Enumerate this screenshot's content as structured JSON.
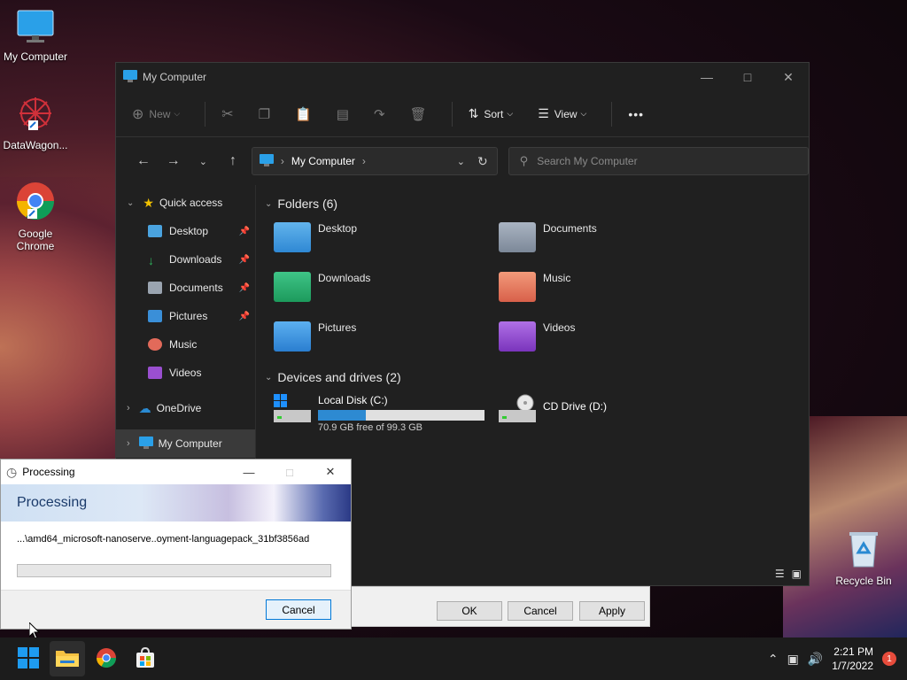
{
  "desktop": {
    "icons": [
      {
        "label": "My Computer",
        "icon": "monitor-icon"
      },
      {
        "label": "DataWagon...",
        "icon": "datawagon-icon"
      },
      {
        "label": "Google Chrome",
        "icon": "chrome-icon"
      },
      {
        "label": "Recycle Bin",
        "icon": "recycle-bin-icon"
      }
    ]
  },
  "explorer": {
    "title": "My Computer",
    "toolbar": {
      "new_label": "New",
      "sort_label": "Sort",
      "view_label": "View",
      "more_label": "•••"
    },
    "address": {
      "crumb": "My Computer"
    },
    "search": {
      "placeholder": "Search My Computer"
    },
    "sidebar": {
      "quick_access": "Quick access",
      "items": [
        {
          "label": "Desktop",
          "pinned": true,
          "color": "#4aa3df"
        },
        {
          "label": "Downloads",
          "pinned": true,
          "color": "#2fb35c"
        },
        {
          "label": "Documents",
          "pinned": true,
          "color": "#9aa4b0"
        },
        {
          "label": "Pictures",
          "pinned": true,
          "color": "#3a8fd8"
        },
        {
          "label": "Music",
          "pinned": false,
          "color": "#e26a5a"
        },
        {
          "label": "Videos",
          "pinned": false,
          "color": "#9a4fd0"
        }
      ],
      "onedrive": "OneDrive",
      "mycomputer": "My Computer"
    },
    "folders_header": "Folders (6)",
    "folders": [
      {
        "label": "Desktop",
        "color": "#3d9be0"
      },
      {
        "label": "Documents",
        "color": "#8a96a6"
      },
      {
        "label": "Downloads",
        "color": "#22a86a"
      },
      {
        "label": "Music",
        "color": "#e6765a"
      },
      {
        "label": "Pictures",
        "color": "#3a8fe0"
      },
      {
        "label": "Videos",
        "color": "#8e44c8"
      }
    ],
    "devices_header": "Devices and drives (2)",
    "drives": {
      "local": {
        "label": "Local Disk (C:)",
        "free": "70.9 GB free of 99.3 GB",
        "used_fraction": 0.286
      },
      "cd": {
        "label": "CD Drive (D:)"
      }
    }
  },
  "back_dialog": {
    "ok": "OK",
    "cancel": "Cancel",
    "apply": "Apply"
  },
  "processing": {
    "title": "Processing",
    "banner": "Processing",
    "path": "...\\amd64_microsoft-nanoserve..oyment-languagepack_31bf3856ad",
    "progress": 0,
    "cancel": "Cancel"
  },
  "taskbar": {
    "time": "2:21 PM",
    "date": "1/7/2022",
    "notifications": "1"
  }
}
